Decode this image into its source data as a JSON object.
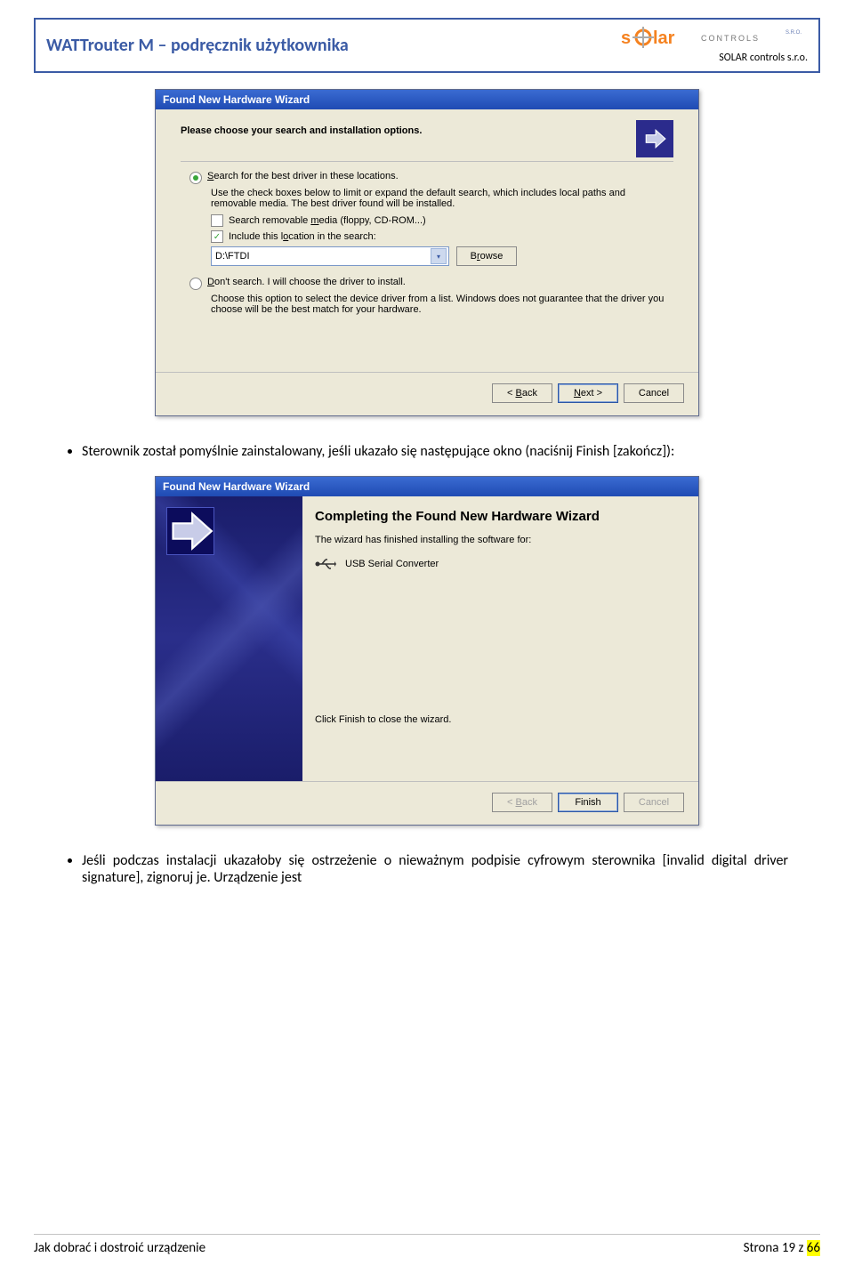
{
  "header": {
    "title": "WATTrouter M – podręcznik użytkownika",
    "logo_text_solar": "s®lar",
    "logo_text_controls": "CONTROLS",
    "logo_sro": "S.R.O.",
    "subtitle": "SOLAR controls s.r.o."
  },
  "wizard1": {
    "title": "Found New Hardware Wizard",
    "heading": "Please choose your search and installation options.",
    "radio1": "Search for the best driver in these locations.",
    "radio1_help": "Use the check boxes below to limit or expand the default search, which includes local paths and removable media. The best driver found will be installed.",
    "check1": "Search removable media (floppy, CD-ROM...)",
    "check2": "Include this location in the search:",
    "path": "D:\\FTDI",
    "browse": "Browse",
    "radio2": "Don't search. I will choose the driver to install.",
    "radio2_help": "Choose this option to select the device driver from a list. Windows does not guarantee that the driver you choose will be the best match for your hardware.",
    "back": "< Back",
    "next": "Next >",
    "cancel": "Cancel"
  },
  "para1": "Sterownik został pomyślnie zainstalowany, jeśli ukazało się następujące okno (naciśnij Finish [zakończ]):",
  "wizard2": {
    "title": "Found New Hardware Wizard",
    "heading": "Completing the Found New Hardware Wizard",
    "line1": "The wizard has finished installing the software for:",
    "device": "USB Serial Converter",
    "close_hint": "Click Finish to close the wizard.",
    "back": "< Back",
    "finish": "Finish",
    "cancel": "Cancel"
  },
  "para2": "Jeśli podczas instalacji ukazałoby się ostrzeżenie o nieważnym podpisie cyfrowym sterownika [invalid digital driver signature], zignoruj je. Urządzenie jest",
  "footer": {
    "left": "Jak dobrać i dostroić urządzenie",
    "right_prefix": "Strona ",
    "page": "19",
    "of": " z ",
    "total": "66"
  }
}
